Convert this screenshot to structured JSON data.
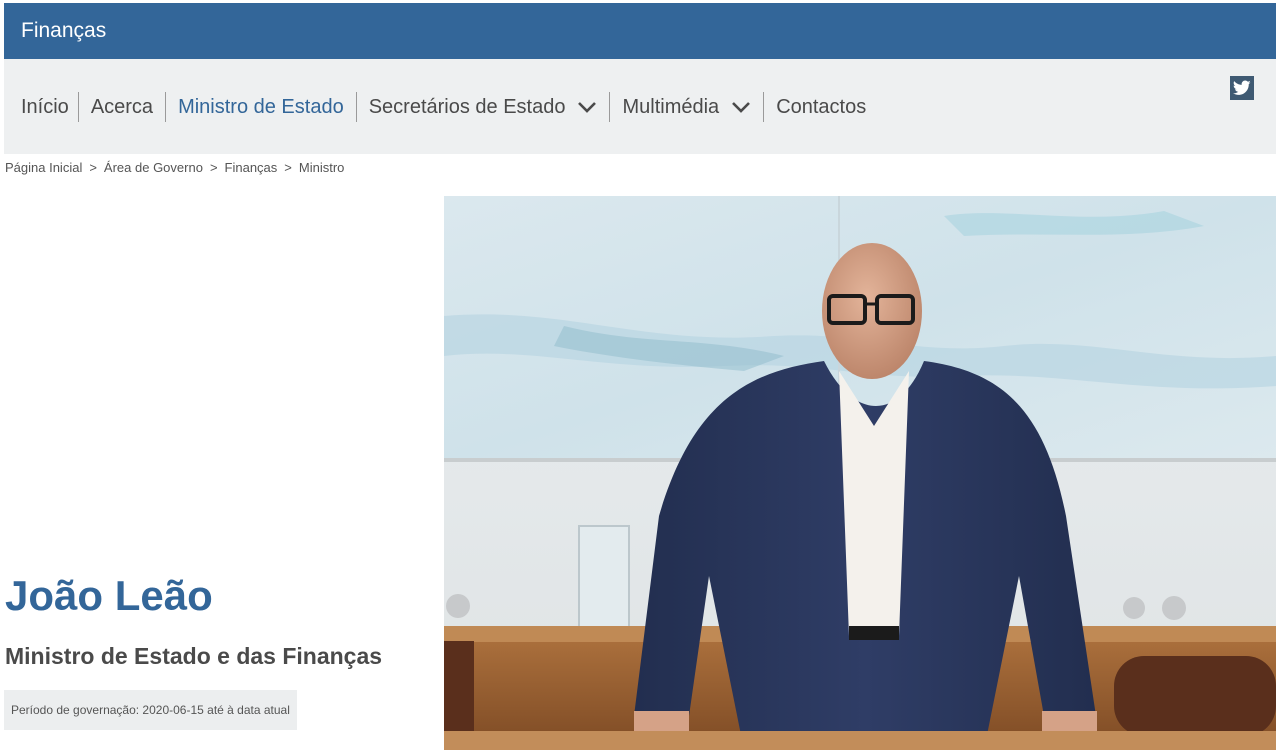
{
  "header": {
    "brand": "Finanças"
  },
  "nav": {
    "items": [
      {
        "label": "Início"
      },
      {
        "label": "Acerca"
      },
      {
        "label": "Ministro de Estado",
        "active": true
      },
      {
        "label": "Secretários de Estado",
        "has_dropdown": true
      },
      {
        "label": "Multimédia",
        "has_dropdown": true
      },
      {
        "label": "Contactos"
      }
    ],
    "social_icon": "twitter-icon"
  },
  "breadcrumb": {
    "items": [
      "Página Inicial",
      "Área de Governo",
      "Finanças",
      "Ministro"
    ],
    "separator": ">"
  },
  "profile": {
    "name": "João Leão",
    "role": "Ministro de Estado e das Finanças",
    "period": "Período de governação: 2020-06-15 até à data atual",
    "photo_icon": "minister-portrait"
  },
  "colors": {
    "brand_blue": "#336699",
    "nav_background": "#eef0f1",
    "text": "#4a4a4a"
  }
}
